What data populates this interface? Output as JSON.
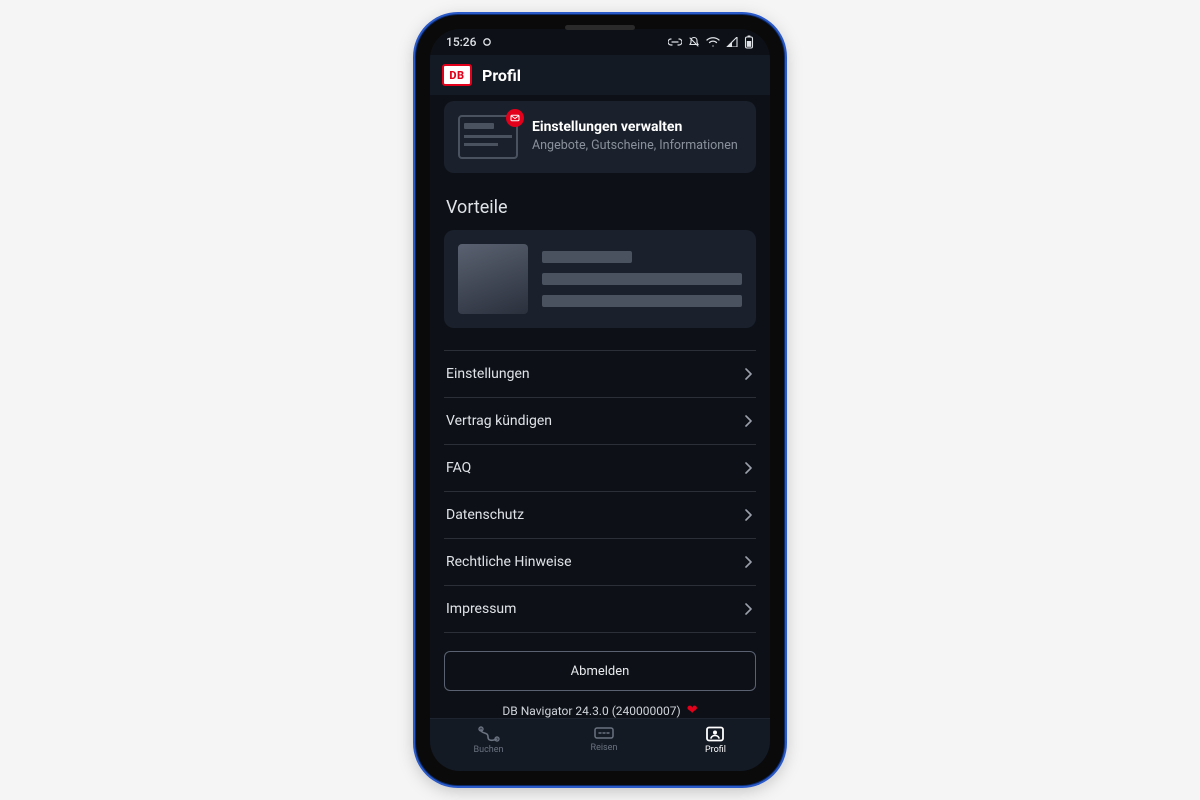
{
  "statusbar": {
    "time": "15:26"
  },
  "header": {
    "logo_text": "DB",
    "title": "Profil"
  },
  "manage_card": {
    "title": "Einstellungen verwalten",
    "subtitle": "Angebote, Gutscheine, Informationen"
  },
  "section": {
    "vorteile_title": "Vorteile"
  },
  "menu": {
    "items": [
      {
        "label": "Einstellungen"
      },
      {
        "label": "Vertrag kündigen"
      },
      {
        "label": "FAQ"
      },
      {
        "label": "Datenschutz"
      },
      {
        "label": "Rechtliche Hinweise"
      },
      {
        "label": "Impressum"
      }
    ]
  },
  "logout": {
    "label": "Abmelden"
  },
  "footer": {
    "version": "DB Navigator 24.3.0 (240000007)"
  },
  "nav": {
    "items": [
      {
        "label": "Buchen"
      },
      {
        "label": "Reisen"
      },
      {
        "label": "Profil"
      }
    ]
  }
}
